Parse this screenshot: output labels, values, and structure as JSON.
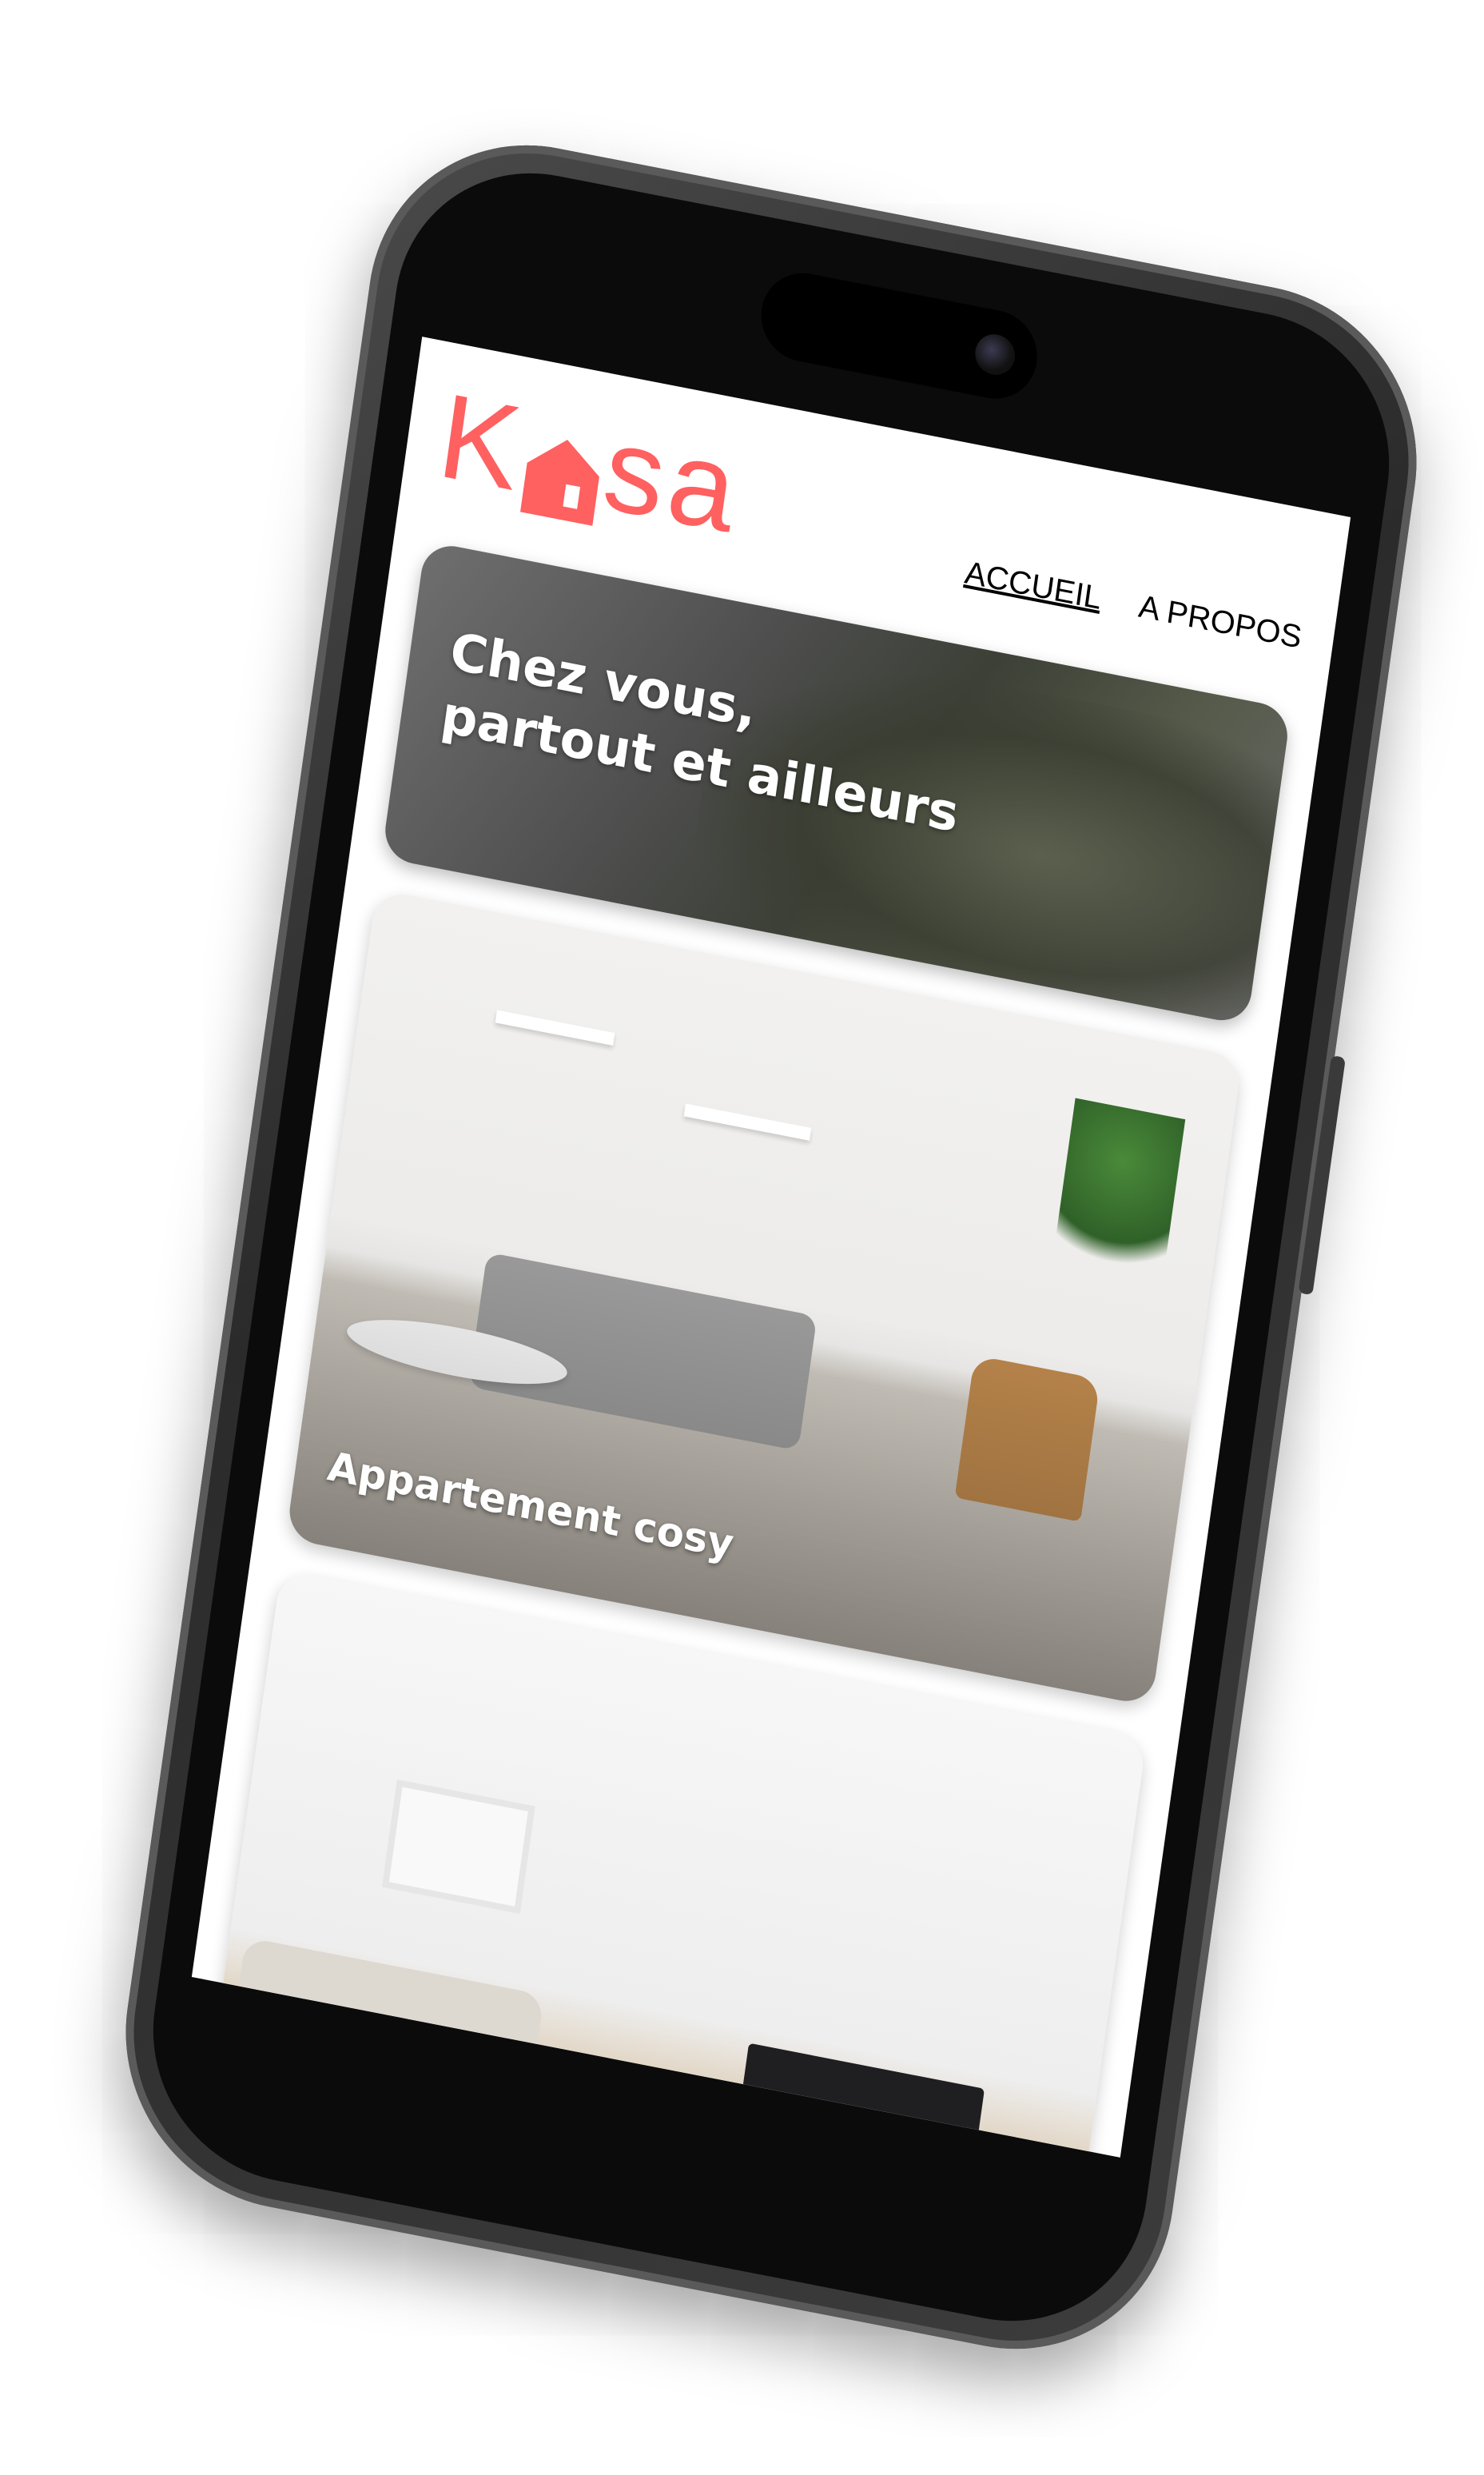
{
  "header": {
    "logo_text_left": "K",
    "logo_text_right": "sa",
    "nav": [
      {
        "label": "ACCUEIL",
        "active": true
      },
      {
        "label": "A PROPOS",
        "active": false
      }
    ]
  },
  "banner": {
    "line1": "Chez vous,",
    "line2": "partout et ailleurs"
  },
  "cards": [
    {
      "title": "Appartement cosy"
    },
    {
      "title": ""
    }
  ],
  "colors": {
    "brand": "#ff6060",
    "phone_frame": "#3a3a3a",
    "screen_bg": "#ffffff"
  },
  "icons": {
    "logo_house": "house-icon",
    "camera": "camera-icon"
  }
}
